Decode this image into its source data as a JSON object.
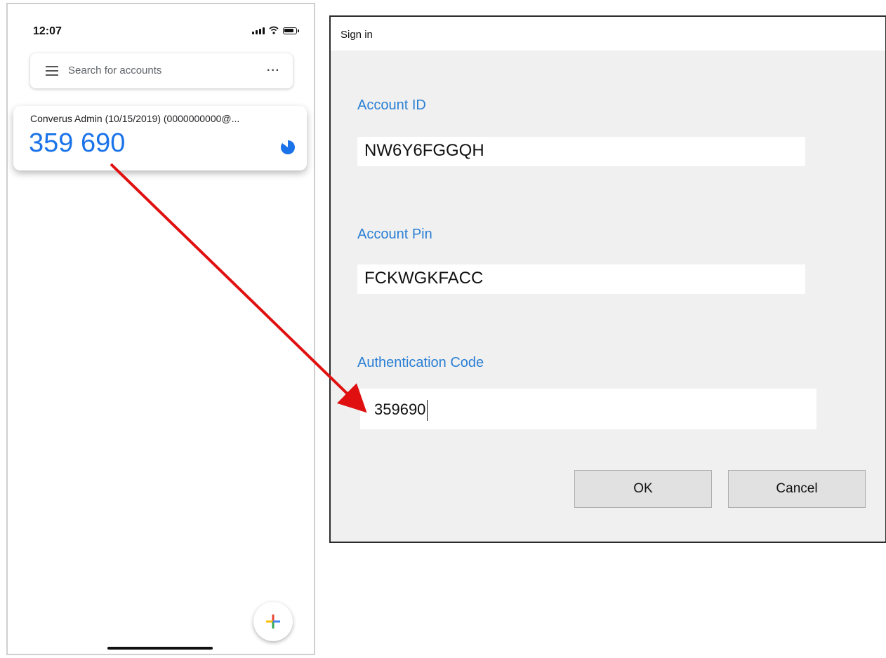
{
  "phone": {
    "status_time": "12:07",
    "search_placeholder": "Search for accounts",
    "more_label": "···",
    "account": {
      "name": "Converus Admin (10/15/2019) (0000000000@...",
      "code": "359 690"
    }
  },
  "dialog": {
    "title": "Sign in",
    "account_id_label": "Account ID",
    "account_id_value": "NW6Y6FGGQH",
    "account_pin_label": "Account Pin",
    "account_pin_value": "FCKWGKFACC",
    "auth_code_label": "Authentication Code",
    "auth_code_value": "359690",
    "ok_label": "OK",
    "cancel_label": "Cancel"
  },
  "colors": {
    "accent_blue": "#1a73e8",
    "label_blue": "#2a7fd4",
    "arrow_red": "#e01010"
  },
  "icons": [
    "menu-icon",
    "more-icon",
    "timer-icon",
    "add-icon",
    "signal-icon",
    "wifi-icon",
    "battery-icon"
  ]
}
